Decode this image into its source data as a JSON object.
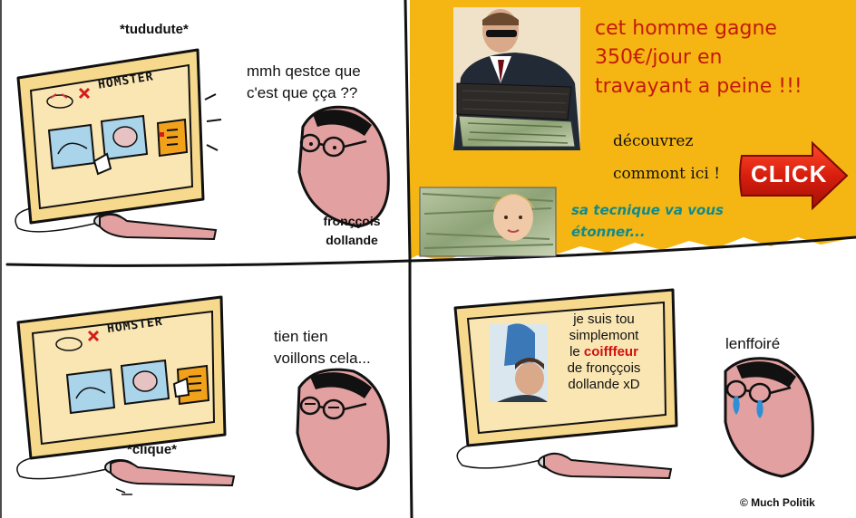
{
  "panel1": {
    "sound": "*tududute*",
    "site_name": "HOMSTER",
    "thought": [
      "mmh qestce que",
      "c'est que çça ??"
    ],
    "character_name": [
      "fronççois",
      "dollande"
    ]
  },
  "ad": {
    "headline": [
      "cet homme gagne",
      "350€/jour en",
      "travayant a peine !!!"
    ],
    "discover": "découvrez",
    "how_here": "commont ici !",
    "button": "CLICK",
    "teaser": [
      "sa tecnique va vous",
      "étonner..."
    ],
    "colors": {
      "background": "#f5b614",
      "headline": "#c41a0a",
      "button": "#d81e0e",
      "teaser": "#138a8a"
    }
  },
  "panel3": {
    "site_name": "HOMSTER",
    "speech": [
      "tien tien",
      "voillons cela..."
    ],
    "sound": "*clique*"
  },
  "panel4": {
    "tv_line1": "je suis tou",
    "tv_line2": "simplemont",
    "tv_line3_prefix": "le ",
    "tv_line3_highlight": "coifffeur",
    "tv_line4": "de fronççois",
    "tv_line5": "dollande xD",
    "speech": "lenffoiré",
    "copyright": "© Much Politik"
  }
}
